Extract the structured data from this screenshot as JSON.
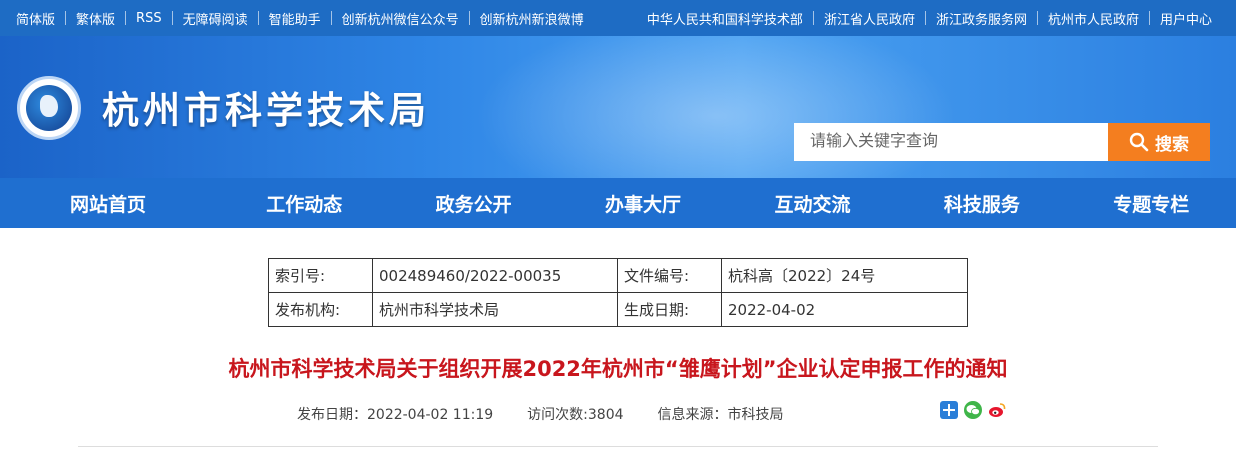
{
  "topbar": {
    "left": [
      "简体版",
      "繁体版",
      "RSS",
      "无障碍阅读",
      "智能助手",
      "创新杭州微信公众号",
      "创新杭州新浪微博"
    ],
    "right": [
      "中华人民共和国科学技术部",
      "浙江省人民政府",
      "浙江政务服务网",
      "杭州市人民政府",
      "用户中心"
    ]
  },
  "header": {
    "site_title": "杭州市科学技术局",
    "search_placeholder": "请输入关键字查询",
    "search_button": "搜索"
  },
  "nav": [
    "网站首页",
    "工作动态",
    "政务公开",
    "办事大厅",
    "互动交流",
    "科技服务",
    "专题专栏"
  ],
  "meta": {
    "index_label": "索引号:",
    "index_value": "002489460/2022-00035",
    "doc_no_label": "文件编号:",
    "doc_no_value": "杭科高〔2022〕24号",
    "publisher_label": "发布机构:",
    "publisher_value": "杭州市科学技术局",
    "date_label": "生成日期:",
    "date_value": "2022-04-02"
  },
  "article": {
    "title": "杭州市科学技术局关于组织开展2022年杭州市“雏鹰计划”企业认定申报工作的通知",
    "publish_date": "发布日期：2022-04-02 11:19",
    "visits": "访问次数:3804",
    "source": "信息来源：市科技局"
  },
  "share_icons": [
    "share-plus-icon",
    "wechat-icon",
    "weibo-icon"
  ],
  "colors": {
    "topbar": "#1e6cc4",
    "nav": "#1f6fd0",
    "search_button": "#f47e1f",
    "title_red": "#c8161d"
  }
}
